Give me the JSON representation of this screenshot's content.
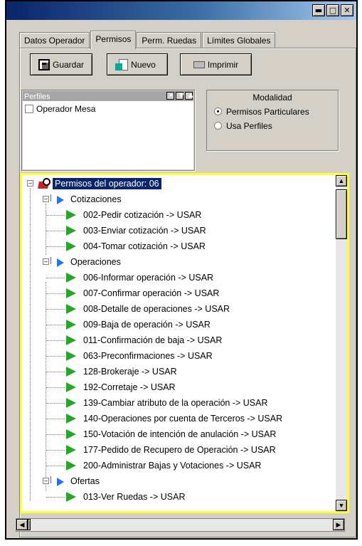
{
  "window": {
    "controls": [
      "minimize-icon",
      "restore-icon",
      "close-icon"
    ]
  },
  "tabs": [
    "Datos Operador",
    "Permisos",
    "Perm. Ruedas",
    "Límites Globales"
  ],
  "active_tab": "Permisos",
  "toolbar": {
    "save_label": "Guardar",
    "new_label": "Nuevo",
    "print_label": "Imprimir"
  },
  "profiles": {
    "header": "Perfiles",
    "items": [
      {
        "label": "Operador Mesa",
        "checked": false
      }
    ]
  },
  "modalidad": {
    "title": "Modalidad",
    "options": [
      {
        "label": "Permisos Particulares",
        "selected": true
      },
      {
        "label": "Usa Perfiles",
        "selected": false
      }
    ]
  },
  "tree": {
    "root": "Permisos del operador: 06",
    "groups": [
      {
        "label": "Cotizaciones",
        "items": [
          "002-Pedir cotización -> USAR",
          "003-Enviar cotización -> USAR",
          "004-Tomar cotización -> USAR"
        ]
      },
      {
        "label": "Operaciones",
        "items": [
          "006-Informar operación -> USAR",
          "007-Confirmar operación -> USAR",
          "008-Detalle de operaciones -> USAR",
          "009-Baja de operación -> USAR",
          "011-Confirmación de baja -> USAR",
          "063-Preconfirmaciones -> USAR",
          "128-Brokeraje -> USAR",
          "192-Corretaje -> USAR",
          "139-Cambiar atributo de la operación -> USAR",
          "140-Operaciones por cuenta de Terceros -> USAR",
          "150-Votación de intención de anulación -> USAR",
          "177-Pedido de Recupero de Operación -> USAR",
          "200-Administrar Bajas y Votaciones -> USAR"
        ]
      },
      {
        "label": "Ofertas",
        "items": [
          "013-Ver Ruedas -> USAR"
        ]
      }
    ]
  },
  "colors": {
    "highlight_border": "#ffff33",
    "selection": "#0a246a",
    "leaf_icon": "#22aa22",
    "folder_arrow": "#1e73ff"
  }
}
